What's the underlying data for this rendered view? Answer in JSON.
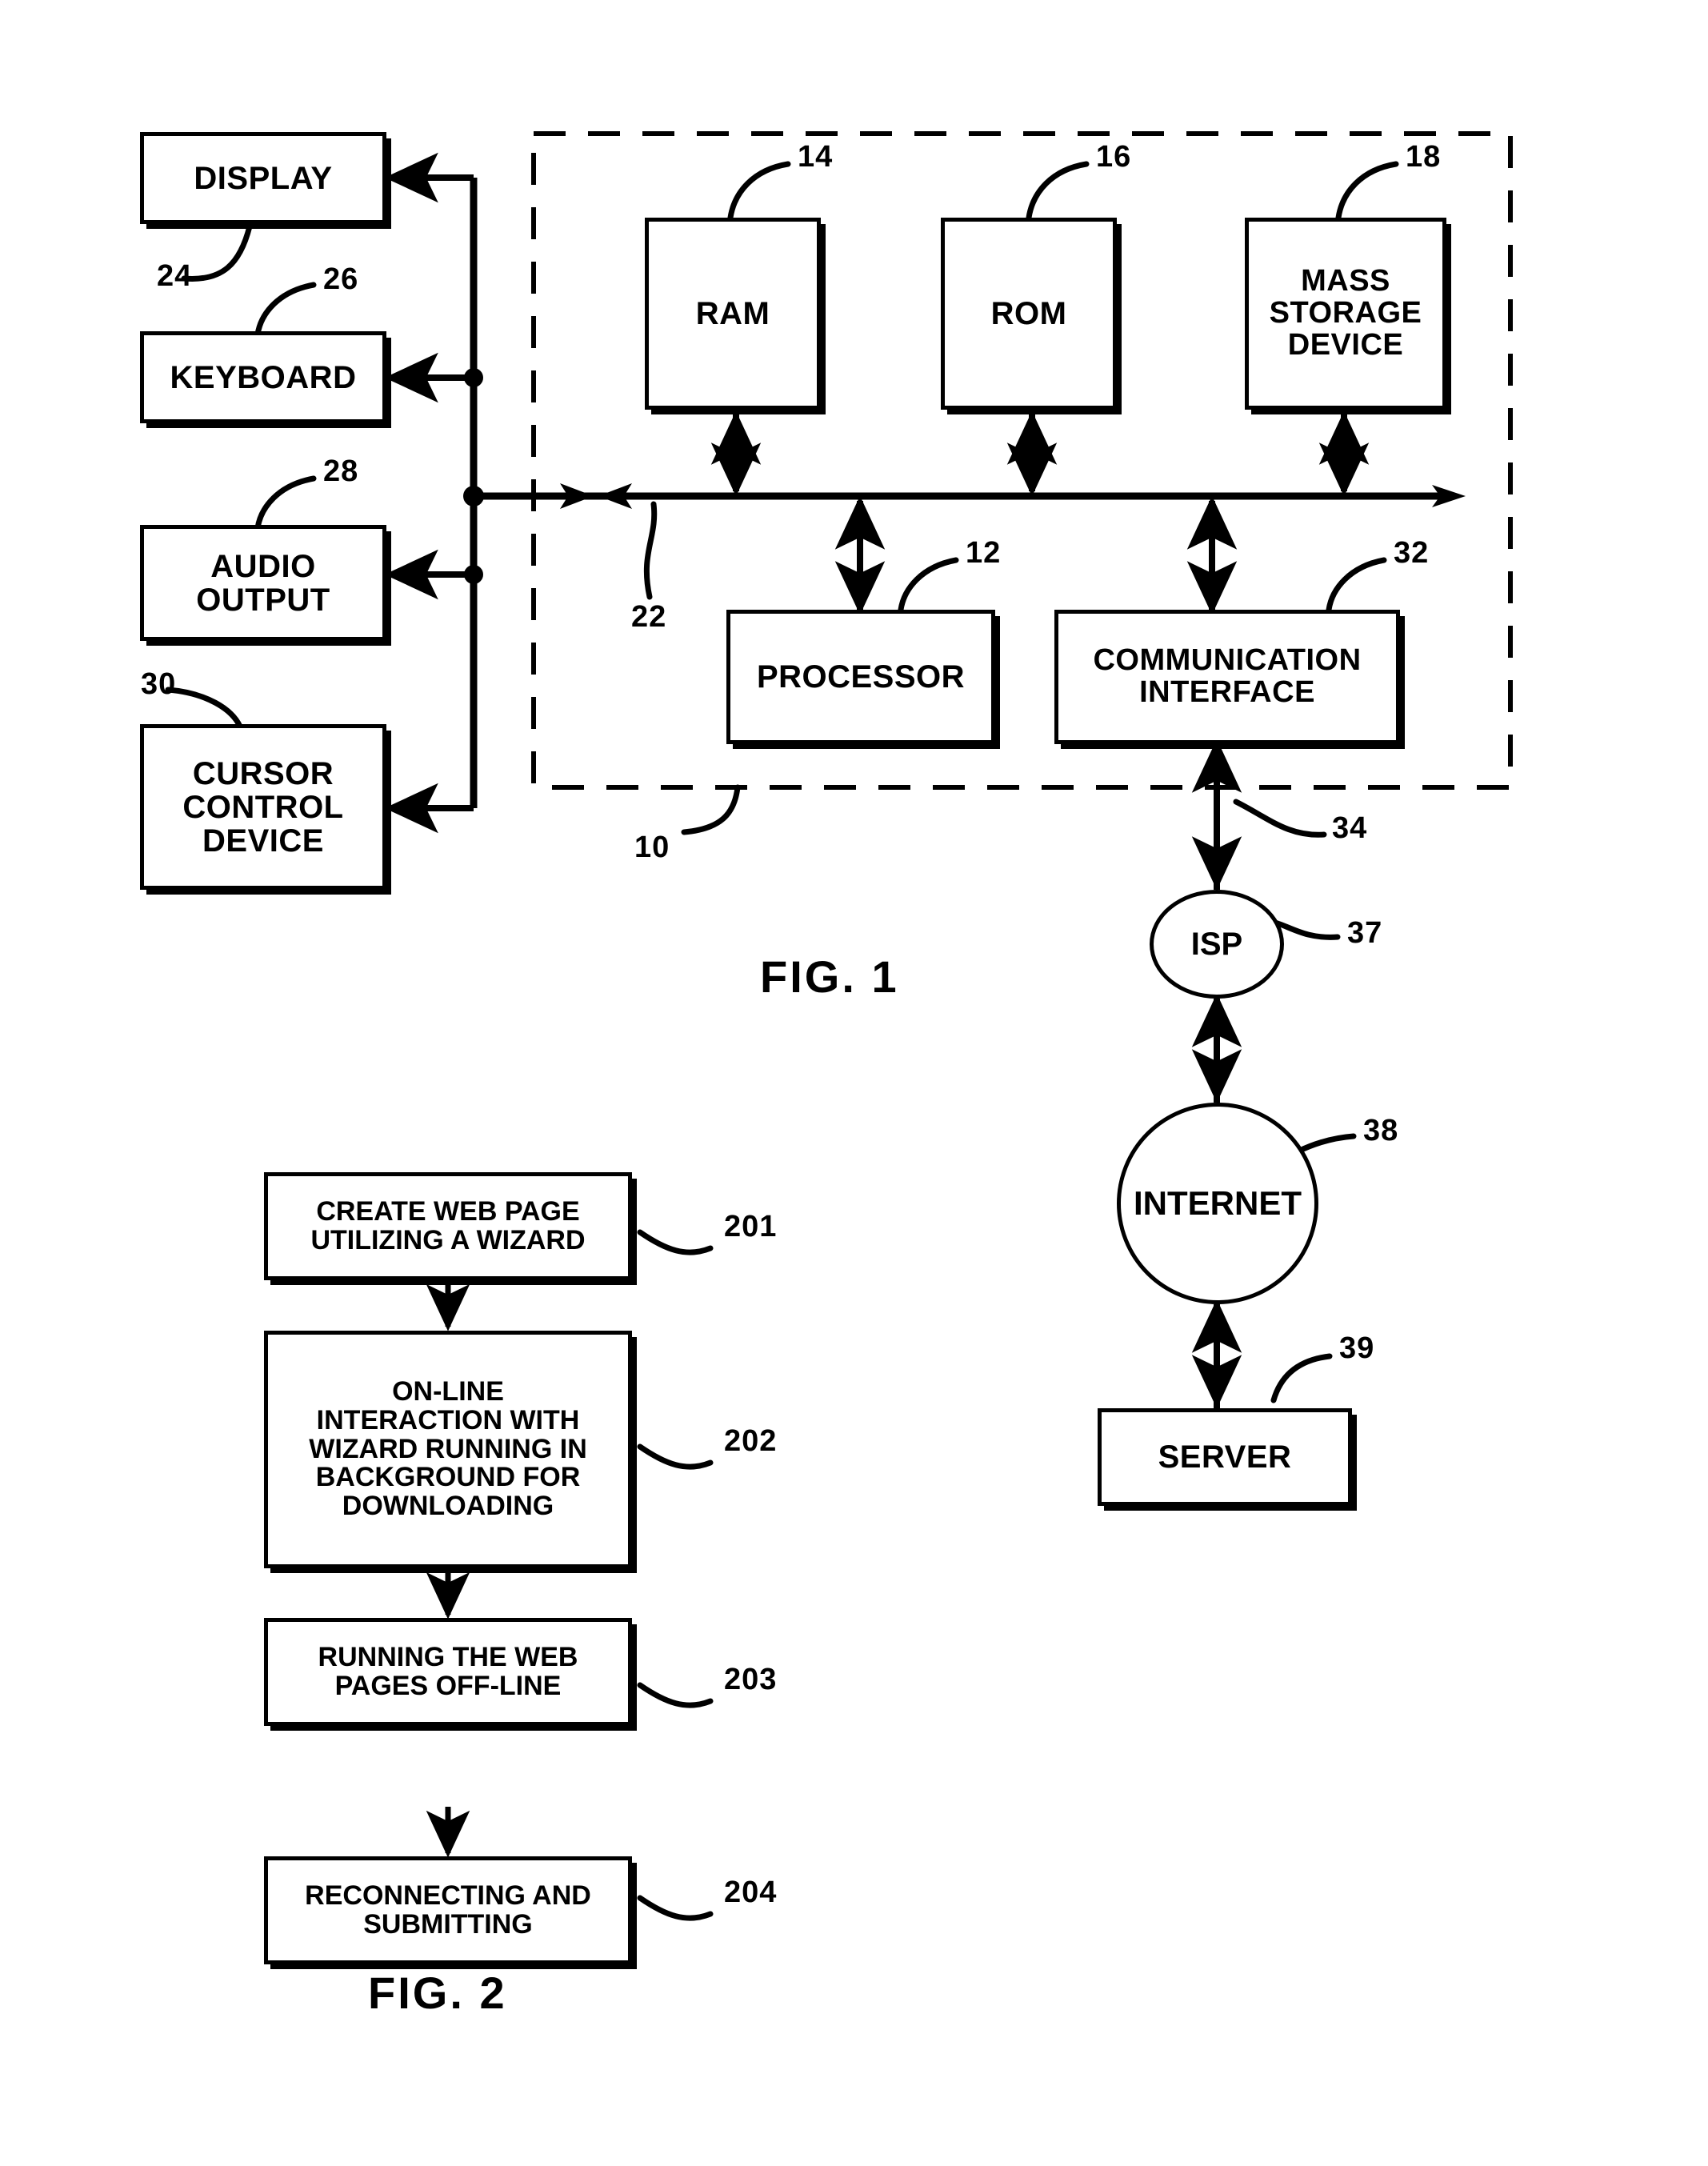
{
  "document": {
    "type": "patent-drawing-sheet",
    "figures": [
      "FIG.  1",
      "FIG.  2"
    ]
  },
  "fig1": {
    "caption": "FIG.  1",
    "system_ref": "10",
    "bus_ref": "22",
    "peripherals": [
      {
        "label": "DISPLAY",
        "ref": "24"
      },
      {
        "label": "KEYBOARD",
        "ref": "26"
      },
      {
        "label_line1": "AUDIO",
        "label_line2": "OUTPUT",
        "ref": "28"
      },
      {
        "label_line1": "CURSOR",
        "label_line2": "CONTROL",
        "label_line3": "DEVICE",
        "ref": "30"
      }
    ],
    "memory": [
      {
        "label": "RAM",
        "ref": "14"
      },
      {
        "label": "ROM",
        "ref": "16"
      },
      {
        "label_line1": "MASS",
        "label_line2": "STORAGE",
        "label_line3": "DEVICE",
        "ref": "18"
      }
    ],
    "core": [
      {
        "label": "PROCESSOR",
        "ref": "12"
      },
      {
        "label_line1": "COMMUNICATION",
        "label_line2": "INTERFACE",
        "ref": "32"
      }
    ],
    "network": [
      {
        "label": "ISP",
        "ref": "37",
        "link_ref": "34"
      },
      {
        "label": "INTERNET",
        "ref": "38"
      },
      {
        "label": "SERVER",
        "ref": "39"
      }
    ]
  },
  "fig2": {
    "caption": "FIG.  2",
    "steps": [
      {
        "ref": "201",
        "lines": [
          "CREATE WEB PAGE",
          "UTILIZING A WIZARD"
        ]
      },
      {
        "ref": "202",
        "lines": [
          "ON-LINE",
          "INTERACTION WITH",
          "WIZARD RUNNING IN",
          "BACKGROUND FOR",
          "DOWNLOADING"
        ]
      },
      {
        "ref": "203",
        "lines": [
          "RUNNING THE WEB",
          "PAGES OFF-LINE"
        ]
      },
      {
        "ref": "204",
        "lines": [
          "RECONNECTING AND",
          "SUBMITTING"
        ]
      }
    ]
  },
  "colors": {
    "ink": "#000000",
    "paper": "#ffffff"
  }
}
